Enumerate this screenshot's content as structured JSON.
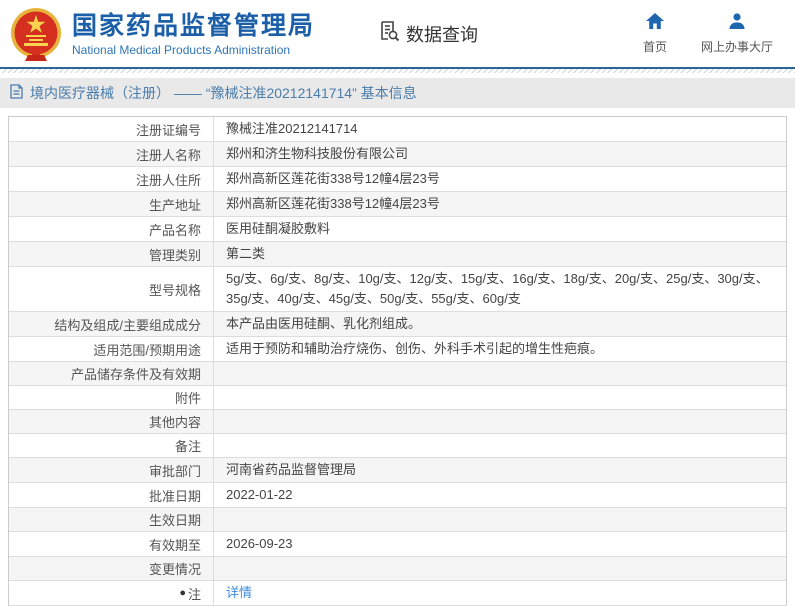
{
  "colors": {
    "brand_blue": "#1b5fa8",
    "subtitle_blue": "#2f77b8",
    "icon_blue": "#1f66b0",
    "breadcrumb_blue": "#4a7dab",
    "link_blue": "#3e8ddd"
  },
  "header": {
    "emblem_icon": "national-emblem-icon",
    "org_name_zh": "国家药品监督管理局",
    "org_name_en": "National Medical Products Administration",
    "query_icon": "doc-search-icon",
    "query_label": "数据查询",
    "home_icon": "home-icon",
    "home_label": "首页",
    "hall_icon": "user-icon",
    "hall_label": "网上办事大厅"
  },
  "breadcrumb": {
    "icon": "document-icon",
    "text": "境内医疗器械（注册） —— “豫械注准20212141714” 基本信息"
  },
  "table": {
    "rows": [
      {
        "label": "注册证编号",
        "value": "豫械注准20212141714"
      },
      {
        "label": "注册人名称",
        "value": "郑州和济生物科技股份有限公司"
      },
      {
        "label": "注册人住所",
        "value": "郑州高新区莲花街338号12幢4层23号"
      },
      {
        "label": "生产地址",
        "value": "郑州高新区莲花街338号12幢4层23号"
      },
      {
        "label": "产品名称",
        "value": "医用硅酮凝胶敷料"
      },
      {
        "label": "管理类别",
        "value": "第二类"
      },
      {
        "label": "型号规格",
        "value": "5g/支、6g/支、8g/支、10g/支、12g/支、15g/支、16g/支、18g/支、20g/支、25g/支、30g/支、35g/支、40g/支、45g/支、50g/支、55g/支、60g/支"
      },
      {
        "label": "结构及组成/主要组成成分",
        "value": "本产品由医用硅酮、乳化剂组成。"
      },
      {
        "label": "适用范围/预期用途",
        "value": "适用于预防和辅助治疗烧伤、创伤、外科手术引起的增生性疤痕。"
      },
      {
        "label": "产品储存条件及有效期",
        "value": ""
      },
      {
        "label": "附件",
        "value": ""
      },
      {
        "label": "其他内容",
        "value": ""
      },
      {
        "label": "备注",
        "value": ""
      },
      {
        "label": "审批部门",
        "value": "河南省药品监督管理局"
      },
      {
        "label": "批准日期",
        "value": "2022-01-22"
      },
      {
        "label": "生效日期",
        "value": ""
      },
      {
        "label": "有效期至",
        "value": "2026-09-23"
      },
      {
        "label": "变更情况",
        "value": ""
      },
      {
        "label": "注",
        "icon": "note-pin-icon",
        "icon_glyph": "●",
        "link": "详情"
      }
    ]
  }
}
